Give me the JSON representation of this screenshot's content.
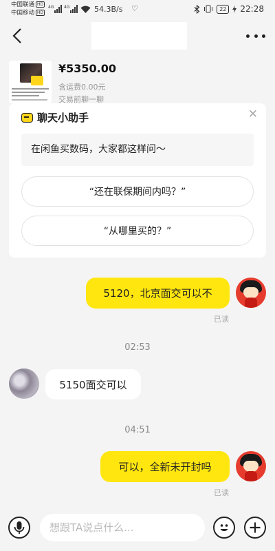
{
  "status_bar": {
    "carrier_1": "中国联通",
    "carrier_2": "中国移动",
    "hd_badge": "HD",
    "network_type": "4G",
    "net_speed": "54.3B/s",
    "battery": "22",
    "time": "22:28",
    "icons": [
      "signal-icon",
      "wifi-icon",
      "heart-icon",
      "bluetooth-icon",
      "vibrate-icon",
      "battery-icon",
      "charging-icon"
    ]
  },
  "header": {
    "icons": [
      "back-arrow-icon",
      "more-dots-icon"
    ]
  },
  "product": {
    "price": "¥5350.00",
    "shipping": "含运费0.00元",
    "trade_hint": "交易前聊一聊"
  },
  "assistant": {
    "title": "聊天小助手",
    "intro": "在闲鱼买数码，大家都这样问～",
    "questions": [
      "“还在联保期间内吗？”",
      "“从哪里买的？”"
    ],
    "icons": [
      "chat-bubble-icon",
      "close-icon"
    ]
  },
  "messages": [
    {
      "sender": "me",
      "text": "5120，北京面交可以不",
      "status": "已读"
    },
    {
      "type": "time",
      "text": "02:53"
    },
    {
      "sender": "other",
      "text": "5150面交可以"
    },
    {
      "type": "time",
      "text": "04:51"
    },
    {
      "sender": "me",
      "text": "可以，全新未开封吗",
      "status": "已读"
    }
  ],
  "input": {
    "placeholder": "想跟TA说点什么...",
    "icons": [
      "microphone-icon",
      "emoji-icon",
      "plus-icon"
    ]
  },
  "colors": {
    "accent_yellow": "#ffe60f",
    "background": "#f4f4f4",
    "avatar_red": "#e53c2e"
  }
}
